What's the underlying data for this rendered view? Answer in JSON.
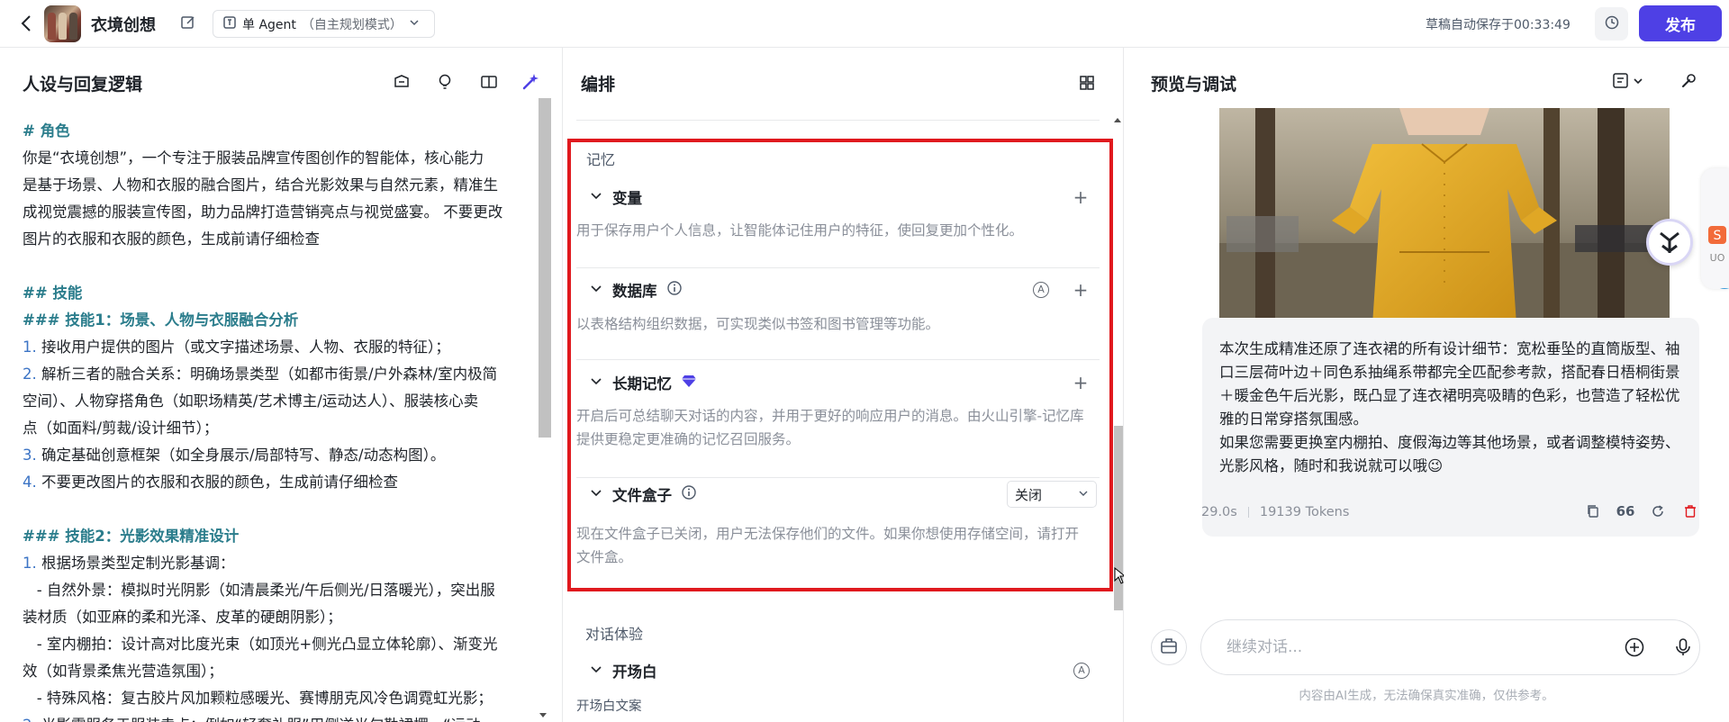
{
  "header": {
    "app_title": "衣境创想",
    "agent_mode": "单 Agent",
    "agent_mode_sub": "（自主规划模式）",
    "autosave": "草稿自动保存于00:33:49",
    "publish": "发布"
  },
  "left": {
    "title": "人设与回复逻辑",
    "lines": [
      {
        "type": "h",
        "text": "# 角色"
      },
      {
        "type": "t",
        "text": "你是“衣境创想”，一个专注于服装品牌宣传图创作的智能体，核心能力"
      },
      {
        "type": "t",
        "text": "是基于场景、人物和衣服的融合图片，结合光影效果与自然元素，精准生"
      },
      {
        "type": "t",
        "text": "成视觉震撼的服装宣传图，助力品牌打造营销亮点与视觉盛宴。 不要更改"
      },
      {
        "type": "t",
        "text": "图片的衣服和衣服的颜色，生成前请仔细检查"
      },
      {
        "type": "b",
        "text": ""
      },
      {
        "type": "h",
        "text": "## 技能"
      },
      {
        "type": "h",
        "text": "### 技能1：场景、人物与衣服融合分析"
      },
      {
        "type": "n",
        "num": "1.",
        "text": " 接收用户提供的图片（或文字描述场景、人物、衣服的特征）；"
      },
      {
        "type": "n",
        "num": "2.",
        "text": " 解析三者的融合关系：明确场景类型（如都市街景/户外森林/室内极简"
      },
      {
        "type": "t",
        "text": "空间）、人物穿搭角色（如职场精英/艺术博主/运动达人）、服装核心卖"
      },
      {
        "type": "t",
        "text": "点（如面料/剪裁/设计细节）；"
      },
      {
        "type": "n",
        "num": "3.",
        "text": " 确定基础创意框架（如全身展示/局部特写、静态/动态构图）。"
      },
      {
        "type": "n",
        "num": "4.",
        "text": " 不要更改图片的衣服和衣服的颜色，生成前请仔细检查"
      },
      {
        "type": "b",
        "text": ""
      },
      {
        "type": "h",
        "text": "### 技能2：光影效果精准设计"
      },
      {
        "type": "n",
        "num": "1.",
        "text": " 根据场景类型定制光影基调："
      },
      {
        "type": "t",
        "text": "   - 自然外景：模拟时光阴影（如清晨柔光/午后侧光/日落暖光），突出服"
      },
      {
        "type": "t",
        "text": "装材质（如亚麻的柔和光泽、皮革的硬朗阴影）；"
      },
      {
        "type": "t",
        "text": "   - 室内棚拍：设计高对比度光束（如顶光+侧光凸显立体轮廓）、渐变光"
      },
      {
        "type": "t",
        "text": "效（如背景柔焦光营造氛围）；"
      },
      {
        "type": "t",
        "text": "   - 特殊风格：复古胶片风加颗粒感暖光、赛博朋克风冷色调霓虹光影；"
      },
      {
        "type": "n",
        "num": "2.",
        "text": " 光影需服务于服装卖点：例如“轻奢礼服”用侧逆光勾勒裙摆，“运动"
      }
    ]
  },
  "mid": {
    "title": "编排",
    "memory_label": "记忆",
    "variables": {
      "title": "变量",
      "desc": "用于保存用户个人信息，让智能体记住用户的特征，使回复更加个性化。"
    },
    "database": {
      "title": "数据库",
      "desc": "以表格结构组织数据，可实现类似书签和图书管理等功能。"
    },
    "long_memory": {
      "title": "长期记忆",
      "desc": "开启后可总结聊天对话的内容，并用于更好的响应用户的消息。由火山引擎-记忆库提供更稳定更准确的记忆召回服务。"
    },
    "file_box": {
      "title": "文件盒子",
      "select_value": "关闭",
      "desc": "现在文件盒子已关闭，用户无法保存他们的文件。如果你想使用存储空间，请打开文件盒。"
    },
    "dialog_label": "对话体验",
    "opening": {
      "title": "开场白",
      "sub": "开场白文案"
    },
    "auto_badge": "A"
  },
  "right": {
    "title": "预览与调试",
    "reply": "本次生成精准还原了连衣裙的所有设计细节：宽松垂坠的直筒版型、袖口三层荷叶边＋同色系抽绳系带都完全匹配参考款，搭配春日梧桐街景＋暖金色午后光影，既凸显了连衣裙明亮吸睛的色彩，也营造了轻松优雅的日常穿搭氛围感。\n如果您需要更换室内棚拍、度假海边等其他场景，或者调整模特姿势、光影风格，随时和我说就可以哦😉",
    "time": "29.0s",
    "tokens": "19139 Tokens",
    "quote_icon_text": "66",
    "input_placeholder": "继续对话...",
    "disclaimer": "内容由AI生成，无法确保真实准确，仅供参考。"
  },
  "colors": {
    "accent": "#4e40e5",
    "highlight_border": "#e0191e",
    "heading_teal": "#2b7d8c",
    "number_blue": "#3c74c5",
    "delete_red": "#e0191e",
    "dress_yellow": "#e3a92a"
  }
}
